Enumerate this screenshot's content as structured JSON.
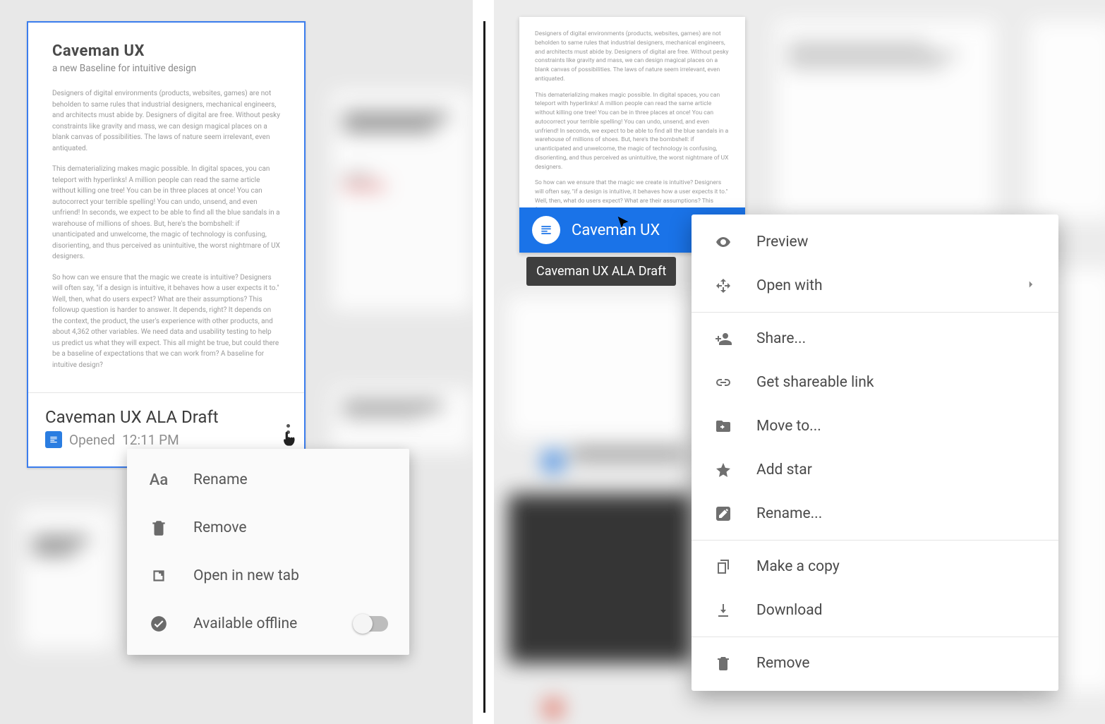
{
  "left": {
    "doc": {
      "title": "Caveman UX",
      "subtitle": "a new Baseline for intuitive design",
      "para1": "Designers of digital environments (products, websites, games) are not beholden to same rules that industrial designers, mechanical engineers, and architects must abide by. Designers of digital are free. Without pesky constraints like gravity and mass, we can design magical places on a blank canvas of possibilities. The laws of nature seem irrelevant, even antiquated.",
      "para2": "This dematerializing makes magic possible. In digital spaces, you can teleport with hyperlinks! A million people can read the same article without killing one tree! You can be in three places at once! You can autocorrect your terrible spelling! You can undo, unsend, and even unfriend! In seconds, we expect to be able to find all the blue sandals in a warehouse of millions of shoes. But, here's the bombshell: if unanticipated and unwelcome, the magic of technology is confusing, disorienting, and thus perceived as unintuitive, the worst nightmare of UX designers.",
      "para3": "So how can we ensure that the magic we create is intuitive? Designers will often say, \"if a design is intuitive, it behaves how a user expects it to.\" Well, then, what do users expect? What are their assumptions? This followup question is harder to answer. It depends, right? It depends on the context, the product, the user's experience with other products, and about 4,362 other variables.  We need data and usability testing to help us predict  us what they will expect. This all might be true, but could there be  a baseline of expectations that we can work from? A baseline for intuitive design?",
      "filename": "Caveman UX ALA Draft",
      "opened_label": "Opened",
      "opened_time": "12:11 PM"
    },
    "menu": {
      "rename": "Rename",
      "remove": "Remove",
      "open_new_tab": "Open in new tab",
      "available_offline": "Available offline"
    }
  },
  "right": {
    "sel": {
      "para1": "Designers of digital environments (products, websites, games) are not beholden to same rules that industrial designers, mechanical engineers, and architects must abide by. Designers of digital are free. Without pesky constraints like gravity and mass, we can design magical places on a blank canvas of possibilities. The laws of nature seem irrelevant, even antiquated.",
      "para2": "This dematerializing makes magic possible. In digital spaces, you can teleport with hyperlinks! A million people can read the same article without killing one tree! You can be in three places at once! You can autocorrect your terrible spelling! You can undo, unsend, and even unfriend! In seconds, we expect to be able to find all the blue sandals in a warehouse of millions of shoes. But, here's the bombshell: if unanticipated and unwelcome, the magic of technology is confusing, disorienting, and thus perceived as unintuitive, the worst nightmare of UX designers.",
      "para3": "So how can we ensure that the magic we create is intuitive? Designers will often say, \"if a design is intuitive, it behaves how a user expects it to.\" Well, then, what do users expect? What are their assumptions? This followup question is harder to answer. It depends, right? It depends on the context, the product, the user's experience with other products, and about 4,362 other variables.  We need data and usability testing to help us predict  us what they will expect. This all might be true, but could there be  a",
      "filename": "Caveman UX",
      "tooltip": "Caveman UX ALA Draft"
    },
    "menu": {
      "preview": "Preview",
      "open_with": "Open with",
      "share": "Share...",
      "get_link": "Get shareable link",
      "move_to": "Move to...",
      "add_star": "Add star",
      "rename": "Rename...",
      "make_copy": "Make a copy",
      "download": "Download",
      "remove": "Remove"
    }
  }
}
